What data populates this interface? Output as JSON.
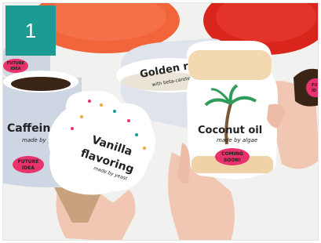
{
  "overlay": {
    "number": "1"
  },
  "cards": {
    "caffeine": {
      "title": "Caffeine",
      "sub": "made by yeast",
      "badge_line1": "FUTURE",
      "badge_line2": "IDEA"
    },
    "vanilla": {
      "title_line1": "Vanilla",
      "title_line2": "flavoring",
      "sub": "made by yeast"
    },
    "golden_rice": {
      "title": "Golden ric",
      "sub": "with beta-caroten"
    },
    "coconut": {
      "title": "Coconut oil",
      "sub": "made by algae",
      "badge_line1": "COMING",
      "badge_line2": "SOON!"
    },
    "left_top": {
      "badge_line1": "FUTURE",
      "badge_line2": "IDEA"
    },
    "right_edge": {
      "badge_line1": "FU",
      "badge_line2": "ID"
    }
  },
  "colors": {
    "teal": "#1c9b92",
    "pink": "#e8336d",
    "plate_orange": "#f2643a",
    "plate_red": "#e0281e"
  }
}
